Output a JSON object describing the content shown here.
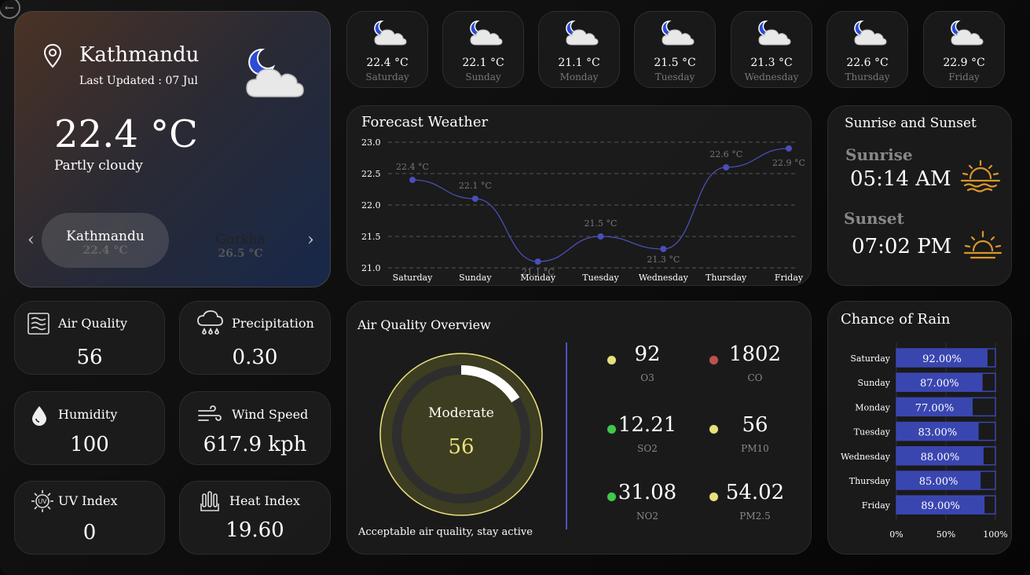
{
  "nav": {
    "back_icon": "back-arrow-icon"
  },
  "location": {
    "city": "Kathmandu",
    "last_updated": "Last Updated : 07 Jul",
    "temperature": "22.4 °C",
    "condition": "Partly cloudy",
    "icon": "moon-cloud-icon"
  },
  "city_carousel": {
    "prev_icon": "chevron-left-icon",
    "next_icon": "chevron-right-icon",
    "cities": [
      {
        "name": "Kathmandu",
        "temp": "22.4 °C",
        "selected": true
      },
      {
        "name": "Gorkha",
        "temp": "26.5 °C",
        "selected": false
      }
    ]
  },
  "daily": [
    {
      "temp": "22.4 °C",
      "day": "Saturday"
    },
    {
      "temp": "22.1 °C",
      "day": "Sunday"
    },
    {
      "temp": "21.1 °C",
      "day": "Monday"
    },
    {
      "temp": "21.5 °C",
      "day": "Tuesday"
    },
    {
      "temp": "21.3 °C",
      "day": "Wednesday"
    },
    {
      "temp": "22.6 °C",
      "day": "Thursday"
    },
    {
      "temp": "22.9 °C",
      "day": "Friday"
    }
  ],
  "forecast": {
    "title": "Forecast Weather",
    "chart_data": {
      "type": "line",
      "categories": [
        "Saturday",
        "Sunday",
        "Monday",
        "Tuesday",
        "Wednesday",
        "Thursday",
        "Friday"
      ],
      "values": [
        22.4,
        22.1,
        21.1,
        21.5,
        21.3,
        22.6,
        22.9
      ],
      "data_labels": [
        "22.4 °C",
        "22.1 °C",
        "21.1 °C",
        "21.5 °C",
        "21.3 °C",
        "22.6 °C",
        "22.9 °C"
      ],
      "ylim": [
        21.0,
        23.0
      ],
      "yticks": [
        "21.0",
        "21.5",
        "22.0",
        "22.5",
        "23.0"
      ],
      "ytick_values": [
        21.0,
        21.5,
        22.0,
        22.5,
        23.0
      ],
      "grid": true,
      "color": "#4a4fb8"
    }
  },
  "sun": {
    "title": "Sunrise and Sunset",
    "sunrise_label": "Sunrise",
    "sunrise_time": "05:14 AM",
    "sunset_label": "Sunset",
    "sunset_time": "07:02 PM",
    "accent": "#d9962b"
  },
  "metrics": {
    "air_quality": {
      "label": "Air Quality",
      "value": "56",
      "icon": "air-icon"
    },
    "precipitation": {
      "label": "Precipitation",
      "value": "0.30",
      "icon": "rain-cloud-icon"
    },
    "humidity": {
      "label": "Humidity",
      "value": "100",
      "icon": "droplet-icon"
    },
    "wind_speed": {
      "label": "Wind Speed",
      "value": "617.9 kph",
      "icon": "wind-icon"
    },
    "uv_index": {
      "label": "UV Index",
      "value": "0",
      "icon": "uv-icon"
    },
    "heat_index": {
      "label": "Heat Index",
      "value": "19.60",
      "icon": "heat-icon"
    }
  },
  "aqi": {
    "title": "Air Quality Overview",
    "status": "Moderate",
    "value": "56",
    "gauge_fraction": 0.16,
    "message": "Acceptable air quality, stay active",
    "items": [
      {
        "value": "92",
        "key": "O3",
        "color": "#e8e07a"
      },
      {
        "value": "1802",
        "key": "CO",
        "color": "#c0504d"
      },
      {
        "value": "12.21",
        "key": "SO2",
        "color": "#3fc84a"
      },
      {
        "value": "56",
        "key": "PM10",
        "color": "#e8e07a"
      },
      {
        "value": "31.08",
        "key": "NO2",
        "color": "#3fc84a"
      },
      {
        "value": "54.02",
        "key": "PM2.5",
        "color": "#e8e07a"
      }
    ]
  },
  "rain": {
    "title": "Chance of Rain",
    "chart_data": {
      "type": "bar",
      "categories": [
        "Saturday",
        "Sunday",
        "Monday",
        "Tuesday",
        "Wednesday",
        "Thursday",
        "Friday"
      ],
      "values": [
        92,
        87,
        77,
        83,
        88,
        85,
        89
      ],
      "data_labels": [
        "92.00%",
        "87.00%",
        "77.00%",
        "83.00%",
        "88.00%",
        "85.00%",
        "89.00%"
      ],
      "xticks": [
        "0%",
        "50%",
        "100%"
      ],
      "xlim": [
        0,
        100
      ],
      "color": "#3a46b0"
    }
  }
}
